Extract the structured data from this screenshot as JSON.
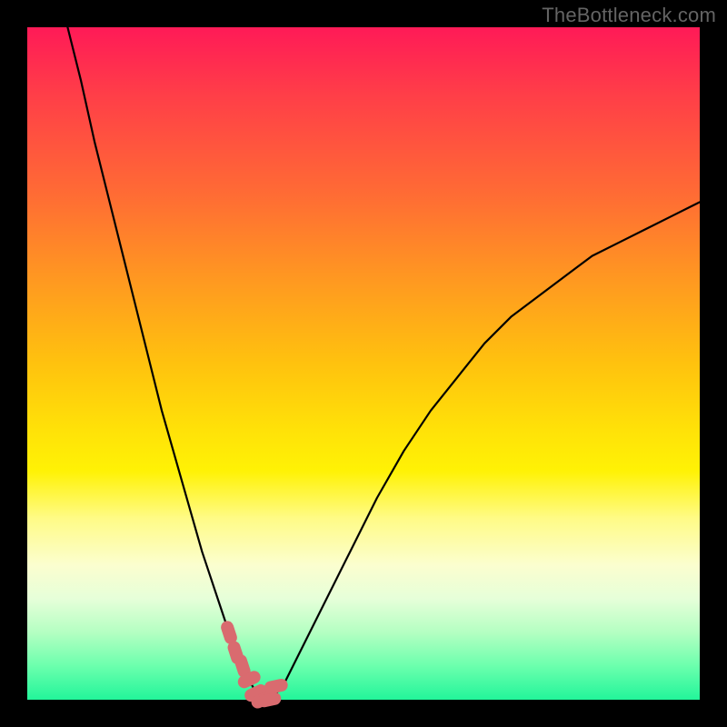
{
  "watermark": "TheBottleneck.com",
  "colors": {
    "frame": "#000000",
    "curve": "#000000",
    "marker": "#d96b6f"
  },
  "chart_data": {
    "type": "line",
    "title": "",
    "xlabel": "",
    "ylabel": "",
    "xlim": [
      0,
      100
    ],
    "ylim": [
      0,
      100
    ],
    "grid": false,
    "legend": false,
    "series": [
      {
        "name": "curve",
        "x": [
          6,
          8,
          10,
          12,
          14,
          16,
          18,
          20,
          22,
          24,
          26,
          28,
          30,
          31,
          32,
          33,
          34,
          36,
          38,
          40,
          44,
          48,
          52,
          56,
          60,
          64,
          68,
          72,
          76,
          80,
          84,
          88,
          92,
          96,
          100
        ],
        "y": [
          100,
          92,
          83,
          75,
          67,
          59,
          51,
          43,
          36,
          29,
          22,
          16,
          10,
          7,
          5,
          3,
          1,
          0,
          2,
          6,
          14,
          22,
          30,
          37,
          43,
          48,
          53,
          57,
          60,
          63,
          66,
          68,
          70,
          72,
          74
        ]
      }
    ],
    "markers": {
      "name": "highlight-segment",
      "x": [
        30,
        31,
        32,
        33,
        34,
        35,
        36,
        37
      ],
      "y": [
        10,
        7,
        5,
        3,
        1,
        0,
        0,
        2
      ]
    }
  }
}
